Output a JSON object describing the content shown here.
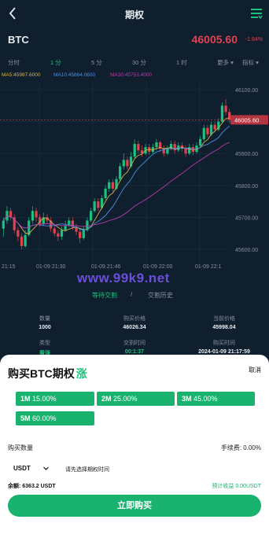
{
  "header": {
    "title": "期权"
  },
  "ticker": {
    "symbol": "BTC",
    "price": "46005.60",
    "change": "-1.84%"
  },
  "timeframes": {
    "items": [
      "分时",
      "1 分",
      "5 分",
      "30 分",
      "1 时",
      "更多 ▾",
      "指标 ▾"
    ],
    "active_index": 1
  },
  "moving_averages": {
    "ma5": "MA5:45987.6000",
    "ma10": "MA10:45864.0600",
    "ma30": "MA30:45753.4000"
  },
  "chart_data": {
    "type": "candlestick",
    "y_ticks": [
      "46100.00",
      "45900.00",
      "45800.00",
      "45700.00",
      "45600.00"
    ],
    "current_price_label": "46005.60",
    "x_ticks": [
      "21:15",
      "01-09 21:30",
      "01-09 21:46",
      "01-09 22:00",
      "01-09 22:1"
    ],
    "colors": {
      "up": "#19c37d",
      "down": "#e0424f",
      "ma5": "#d4b04a",
      "ma10": "#4b8fe0",
      "ma30": "#b43ca8"
    },
    "candles": [
      [
        45665,
        45690,
        45640,
        45700
      ],
      [
        45690,
        45720,
        45680,
        45735
      ],
      [
        45720,
        45700,
        45690,
        45730
      ],
      [
        45700,
        45660,
        45650,
        45710
      ],
      [
        45660,
        45640,
        45625,
        45670
      ],
      [
        45640,
        45610,
        45600,
        45650
      ],
      [
        45610,
        45645,
        45605,
        45660
      ],
      [
        45645,
        45690,
        45640,
        45700
      ],
      [
        45690,
        45720,
        45680,
        45735
      ],
      [
        45720,
        45700,
        45685,
        45730
      ],
      [
        45700,
        45680,
        45670,
        45710
      ],
      [
        45680,
        45700,
        45675,
        45715
      ],
      [
        45700,
        45690,
        45680,
        45710
      ],
      [
        45690,
        45665,
        45655,
        45700
      ],
      [
        45665,
        45650,
        45640,
        45675
      ],
      [
        45650,
        45640,
        45625,
        45660
      ],
      [
        45640,
        45660,
        45630,
        45670
      ],
      [
        45660,
        45675,
        45655,
        45690
      ],
      [
        45675,
        45690,
        45670,
        45700
      ],
      [
        45690,
        45670,
        45660,
        45700
      ],
      [
        45670,
        45655,
        45645,
        45680
      ],
      [
        45655,
        45635,
        45620,
        45665
      ],
      [
        45635,
        45660,
        45630,
        45670
      ],
      [
        45660,
        45690,
        45655,
        45700
      ],
      [
        45690,
        45720,
        45685,
        45730
      ],
      [
        45720,
        45750,
        45715,
        45760
      ],
      [
        45750,
        45730,
        45720,
        45760
      ],
      [
        45730,
        45760,
        45725,
        45770
      ],
      [
        45760,
        45790,
        45755,
        45800
      ],
      [
        45790,
        45810,
        45780,
        45820
      ],
      [
        45810,
        45790,
        45780,
        45820
      ],
      [
        45790,
        45820,
        45785,
        45830
      ],
      [
        45820,
        45860,
        45815,
        45870
      ],
      [
        45860,
        45880,
        45850,
        45900
      ],
      [
        45880,
        45860,
        45850,
        45890
      ],
      [
        45860,
        45890,
        45855,
        45905
      ],
      [
        45890,
        45930,
        45885,
        45945
      ],
      [
        45930,
        45910,
        45900,
        45940
      ],
      [
        45910,
        45900,
        45890,
        45925
      ],
      [
        45900,
        45920,
        45895,
        45930
      ],
      [
        45920,
        45905,
        45895,
        45930
      ],
      [
        45905,
        45920,
        45900,
        45930
      ],
      [
        45920,
        45935,
        45910,
        45945
      ],
      [
        45935,
        45915,
        45905,
        45940
      ],
      [
        45915,
        45900,
        45890,
        45925
      ],
      [
        45900,
        45915,
        45895,
        45925
      ],
      [
        45915,
        45930,
        45910,
        45940
      ],
      [
        45930,
        45910,
        45900,
        45940
      ],
      [
        45910,
        45925,
        45905,
        45935
      ],
      [
        45925,
        45915,
        45905,
        45935
      ],
      [
        45915,
        45900,
        45890,
        45925
      ],
      [
        45900,
        45920,
        45895,
        45930
      ],
      [
        45920,
        45905,
        45895,
        45930
      ],
      [
        45905,
        45925,
        45900,
        45935
      ],
      [
        45925,
        45945,
        45920,
        45955
      ],
      [
        45945,
        45980,
        45940,
        45990
      ],
      [
        45980,
        45960,
        45950,
        45990
      ],
      [
        45960,
        45990,
        45955,
        46000
      ],
      [
        45990,
        45975,
        45965,
        46000
      ],
      [
        45975,
        46000,
        45970,
        46010
      ],
      [
        46000,
        46050,
        45995,
        46060
      ],
      [
        46050,
        46030,
        46020,
        46070
      ],
      [
        46030,
        46005,
        45995,
        46040
      ]
    ]
  },
  "order_tabs": {
    "waiting": "等待交割",
    "separator": "/",
    "history": "交割历史"
  },
  "order_info": {
    "qty_label": "数量",
    "qty_value": "1000",
    "buy_price_label": "购买价格",
    "buy_price_value": "46026.34",
    "current_price_label": "当前价格",
    "current_price_value": "45998.04",
    "type_label": "类型",
    "type_value": "看涨",
    "delivery_time_label": "交割时间",
    "delivery_time_value": "00:1:37",
    "buy_time_label": "购买时间",
    "buy_time_value": "2024-01-09 21:17:59"
  },
  "sheet": {
    "title": "购买BTC期权",
    "direction": "涨",
    "cancel": "取消",
    "periods": [
      {
        "name": "1M",
        "rate": "15.00%"
      },
      {
        "name": "2M",
        "rate": "25.00%"
      },
      {
        "name": "3M",
        "rate": "45.00%"
      },
      {
        "name": "5M",
        "rate": "60.00%"
      }
    ],
    "qty_label": "购买数量",
    "fee": "手续费: 0.00%",
    "currency": "USDT",
    "time_hint": "请先选择期权时间",
    "balance": "余额: 6363.2 USDT",
    "expected": "预计收益 0.00USDT",
    "buy_button": "立即购买"
  }
}
